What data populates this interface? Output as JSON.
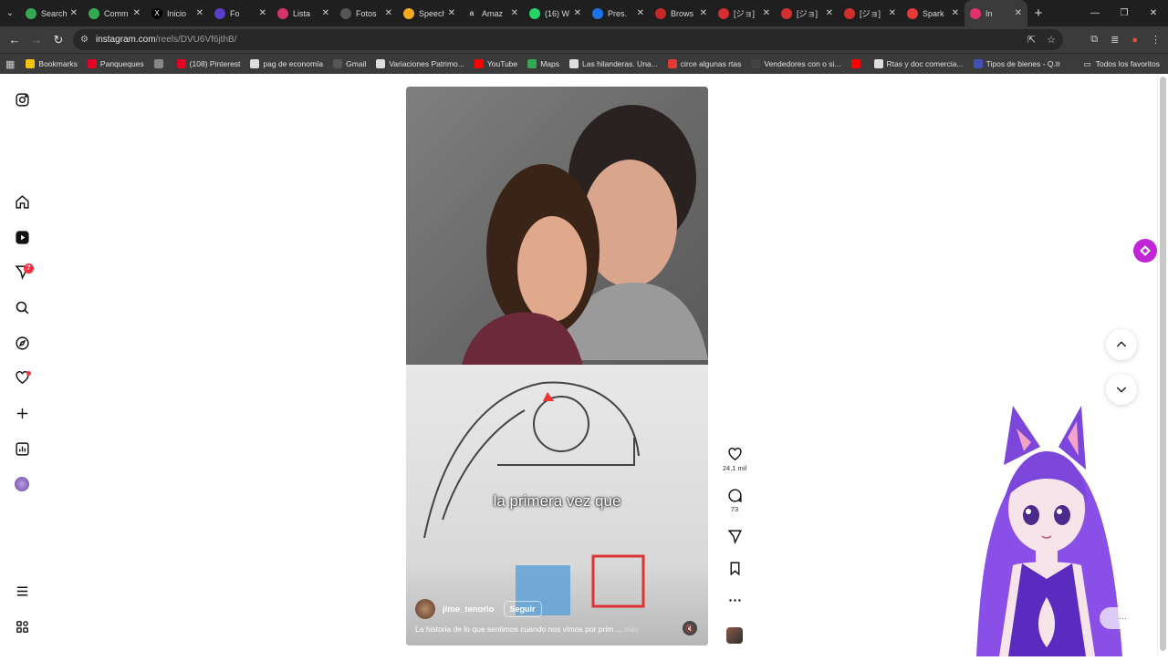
{
  "browser": {
    "tabs": [
      {
        "title": "Search",
        "color": "#34a853",
        "glyph": ""
      },
      {
        "title": "Comm",
        "color": "#34a853",
        "glyph": ""
      },
      {
        "title": "Inicio",
        "color": "#000000",
        "glyph": "X"
      },
      {
        "title": "Fo",
        "color": "#5b3ec8",
        "glyph": ""
      },
      {
        "title": "Lista",
        "color": "#d6336c",
        "glyph": ""
      },
      {
        "title": "Fotos",
        "color": "#555555",
        "glyph": ""
      },
      {
        "title": "Speech",
        "color": "#f6a821",
        "glyph": ""
      },
      {
        "title": "Amaz",
        "color": "#222222",
        "glyph": "a"
      },
      {
        "title": "(16) W",
        "color": "#25d366",
        "glyph": ""
      },
      {
        "title": "Pres.",
        "color": "#1a73e8",
        "glyph": ""
      },
      {
        "title": "Brows",
        "color": "#c62828",
        "glyph": ""
      },
      {
        "title": "[ジョ]",
        "color": "#d32f2f",
        "glyph": ""
      },
      {
        "title": "[ジョ]",
        "color": "#d32f2f",
        "glyph": ""
      },
      {
        "title": "[ジョ]",
        "color": "#d32f2f",
        "glyph": ""
      },
      {
        "title": "Spark",
        "color": "#e53935",
        "glyph": ""
      },
      {
        "title": "In",
        "color": "#e1306c",
        "glyph": ""
      }
    ],
    "url_host": "instagram.com",
    "url_path": "/reels/DVU6Vf6jthB/",
    "bookmarks": [
      {
        "label": "Bookmarks",
        "color": "#f1c40f"
      },
      {
        "label": "Panqueques",
        "color": "#e60023"
      },
      {
        "label": "",
        "color": "#888888"
      },
      {
        "label": "(108) Pinterest",
        "color": "#e60023"
      },
      {
        "label": "pag de economía",
        "color": "#dddddd"
      },
      {
        "label": "Gmail",
        "color": "#555555"
      },
      {
        "label": "Variaciones Patrimo...",
        "color": "#dddddd"
      },
      {
        "label": "YouTube",
        "color": "#ff0000"
      },
      {
        "label": "Maps",
        "color": "#34a853"
      },
      {
        "label": "Las hilanderas. Una...",
        "color": "#dddddd"
      },
      {
        "label": "circe algunas rtas",
        "color": "#e53935"
      },
      {
        "label": "Vendedores con o si...",
        "color": "#444444"
      },
      {
        "label": "",
        "color": "#ff0000"
      },
      {
        "label": "Rtas y doc comercia...",
        "color": "#dddddd"
      },
      {
        "label": "Tipos de bienes - Q...",
        "color": "#3f51b5"
      }
    ],
    "all_bookmarks": "Todos los favoritos"
  },
  "sidebar": {
    "notification_count": "7"
  },
  "reel": {
    "subtitle": "la primera vez que",
    "username": "jime_tenorio",
    "follow_label": "Seguir",
    "caption": "La historia de lo que sentimos cuando nos vimos por prim ...",
    "caption_more": "más"
  },
  "actions": {
    "likes": "24,1 mil",
    "comments": "73"
  }
}
